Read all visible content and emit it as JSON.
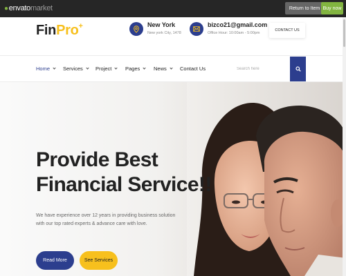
{
  "envato": {
    "logo_main": "envato",
    "logo_market": "market",
    "return_label": "Return to Item",
    "buy_label": "Buy now"
  },
  "brand": {
    "fin": "Fin",
    "pro": "Pro",
    "plus": "+"
  },
  "header": {
    "location_title": "New York",
    "location_sub": "New york City, 1478",
    "email_title": "bizco21@gmail.com",
    "email_sub": "Office Hour: 10:00am - 5:00pm",
    "contact_label": "CONTACT US"
  },
  "nav": {
    "items": [
      {
        "label": "Home"
      },
      {
        "label": "Services"
      },
      {
        "label": "Project"
      },
      {
        "label": "Pages"
      },
      {
        "label": "News"
      },
      {
        "label": "Contact Us"
      }
    ],
    "search_placeholder": "Search here"
  },
  "hero": {
    "title_line1": "Provide Best",
    "title_line2": "Financial Service!!",
    "text": "We have experience over 12 years in providing business solution with our top rated experts & advance care with love.",
    "read_more": "Read More",
    "see_services": "See Services"
  },
  "colors": {
    "primary": "#2c3e8e",
    "accent": "#f7c01d",
    "envato_green": "#82b440",
    "envato_bar": "#262626"
  },
  "icons": {
    "location": "map-pin-icon",
    "email": "envelope-icon",
    "search": "search-icon"
  }
}
